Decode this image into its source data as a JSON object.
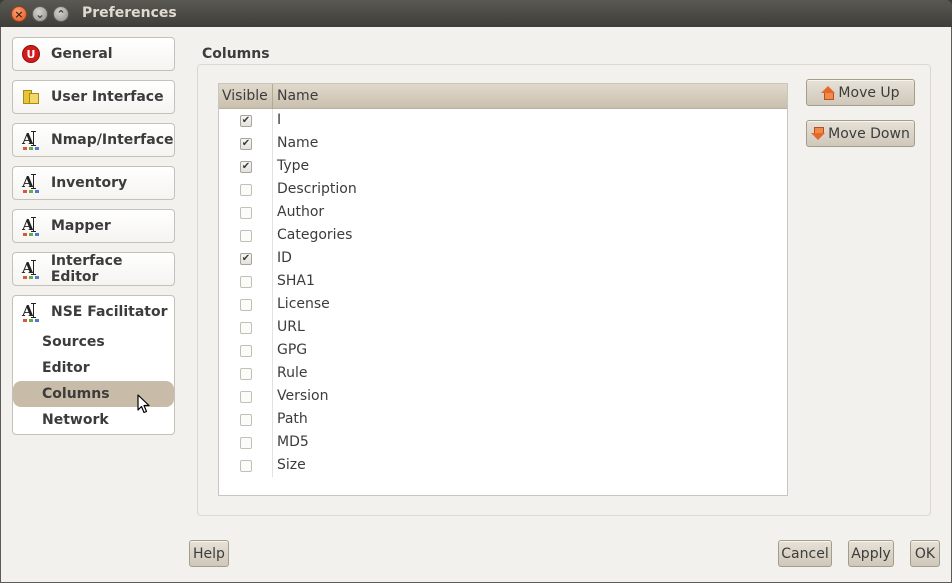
{
  "window": {
    "title": "Preferences"
  },
  "sidebar": {
    "categories": [
      {
        "label": "General",
        "icon": "umit-logo-icon"
      },
      {
        "label": "User Interface",
        "icon": "user-interface-icon"
      },
      {
        "label": "Nmap/Interface",
        "icon": "font-icon"
      },
      {
        "label": "Inventory",
        "icon": "font-icon"
      },
      {
        "label": "Mapper",
        "icon": "font-icon"
      },
      {
        "label": "Interface Editor",
        "icon": "font-icon"
      }
    ],
    "nse": {
      "label": "NSE Facilitator",
      "icon": "font-icon",
      "items": [
        "Sources",
        "Editor",
        "Columns",
        "Network"
      ],
      "selected": "Columns"
    }
  },
  "columns": {
    "title": "Columns",
    "header_visible": "Visible",
    "header_name": "Name",
    "rows": [
      {
        "name": "I",
        "visible": true
      },
      {
        "name": "Name",
        "visible": true
      },
      {
        "name": "Type",
        "visible": true
      },
      {
        "name": "Description",
        "visible": false
      },
      {
        "name": "Author",
        "visible": false
      },
      {
        "name": "Categories",
        "visible": false
      },
      {
        "name": "ID",
        "visible": true
      },
      {
        "name": "SHA1",
        "visible": false
      },
      {
        "name": "License",
        "visible": false
      },
      {
        "name": "URL",
        "visible": false
      },
      {
        "name": "GPG",
        "visible": false
      },
      {
        "name": "Rule",
        "visible": false
      },
      {
        "name": "Version",
        "visible": false
      },
      {
        "name": "Path",
        "visible": false
      },
      {
        "name": "MD5",
        "visible": false
      },
      {
        "name": "Size",
        "visible": false
      }
    ],
    "move_up": "Move Up",
    "move_down": "Move Down"
  },
  "footer": {
    "help": "Help",
    "cancel": "Cancel",
    "apply": "Apply",
    "ok": "OK"
  },
  "colors": {
    "titlebar": "#3e3d39",
    "background": "#f2f1ed",
    "selection": "#c8bca8",
    "button": "#d8d1c4",
    "accent_arrow": "#e5682b"
  }
}
